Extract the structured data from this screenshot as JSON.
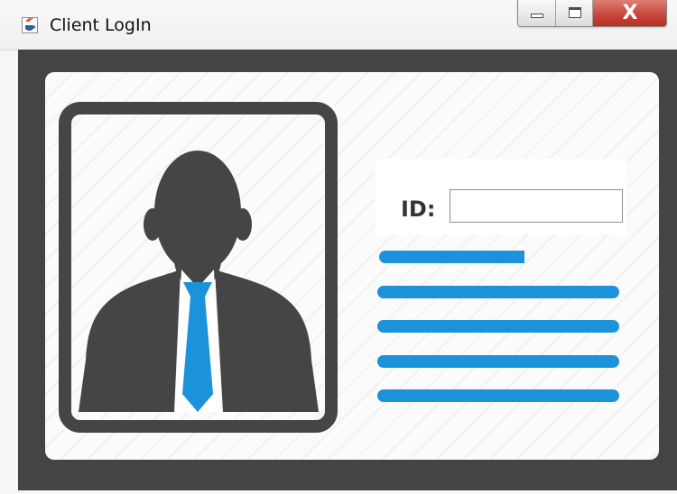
{
  "window": {
    "title": "Client LogIn",
    "controls": {
      "minimize_icon": "minimize-icon",
      "maximize_icon": "maximize-icon",
      "close_label": "X"
    }
  },
  "login_card": {
    "id_label": "ID:",
    "id_input": {
      "value": "",
      "placeholder": ""
    },
    "avatar_icon": "person-avatar-icon"
  },
  "colors": {
    "frame": "#444444",
    "card": "#fbfbfb",
    "accent_blue": "#1b92da",
    "avatar_gray": "#454545",
    "close_red": "#c7463a"
  }
}
